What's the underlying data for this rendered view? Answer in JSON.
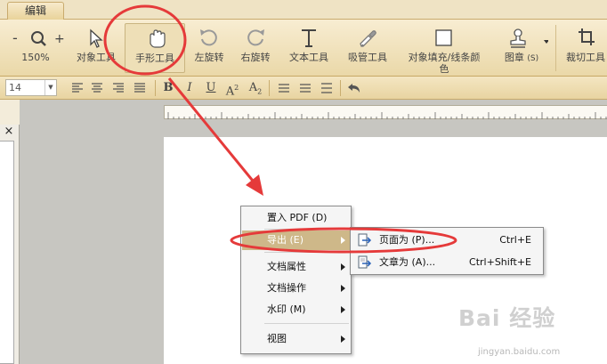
{
  "tabs": {
    "edit": "编辑"
  },
  "ribbon": {
    "zoom_out": "-",
    "zoom_in": "+",
    "zoom_level": "150%",
    "object_tool": "对象工具",
    "hand_tool": "手形工具",
    "rotate_left": "左旋转",
    "rotate_right": "右旋转",
    "text_tool": "文本工具",
    "eyedropper": "吸管工具",
    "fill_stroke_line1": "对象填充/线条颜",
    "fill_stroke_line2": "色",
    "stamp": "图章",
    "stamp_key": "(S)",
    "crop_tool": "裁切工具"
  },
  "format_bar": {
    "font_size": "14",
    "bold": "B",
    "italic": "I",
    "underline": "U",
    "superscript": "A",
    "superscript_mark": "2",
    "subscript": "A",
    "subscript_mark": "2"
  },
  "left_panel": {
    "close": "×"
  },
  "context_menu": {
    "items": [
      {
        "label": "置入 PDF (D)"
      },
      {
        "label": "导出 (E)"
      },
      {
        "label": "文档属性"
      },
      {
        "label": "文档操作"
      },
      {
        "label": "水印 (M)"
      },
      {
        "label": "视图"
      }
    ]
  },
  "export_submenu": {
    "items": [
      {
        "label": "页面为 (P)...",
        "shortcut": "Ctrl+E"
      },
      {
        "label": "文章为 (A)...",
        "shortcut": "Ctrl+Shift+E"
      }
    ]
  },
  "watermark": {
    "logo": "Bai 经验",
    "url": "jingyan.baidu.com"
  },
  "colors": {
    "ribbon_bg": "#ead8a8",
    "menu_highlight": "#ceb889",
    "annotation_red": "#e53a3a"
  },
  "icons": [
    "zoom-icon",
    "cursor-arrow-icon",
    "hand-icon",
    "rotate-left-icon",
    "rotate-right-icon",
    "text-t-icon",
    "eyedropper-icon",
    "fill-square-icon",
    "stamp-icon",
    "crop-icon",
    "align-left-icon",
    "align-center-icon",
    "align-right-icon",
    "justify-icon",
    "list-icon",
    "undo-icon",
    "export-page-icon",
    "export-article-icon"
  ]
}
